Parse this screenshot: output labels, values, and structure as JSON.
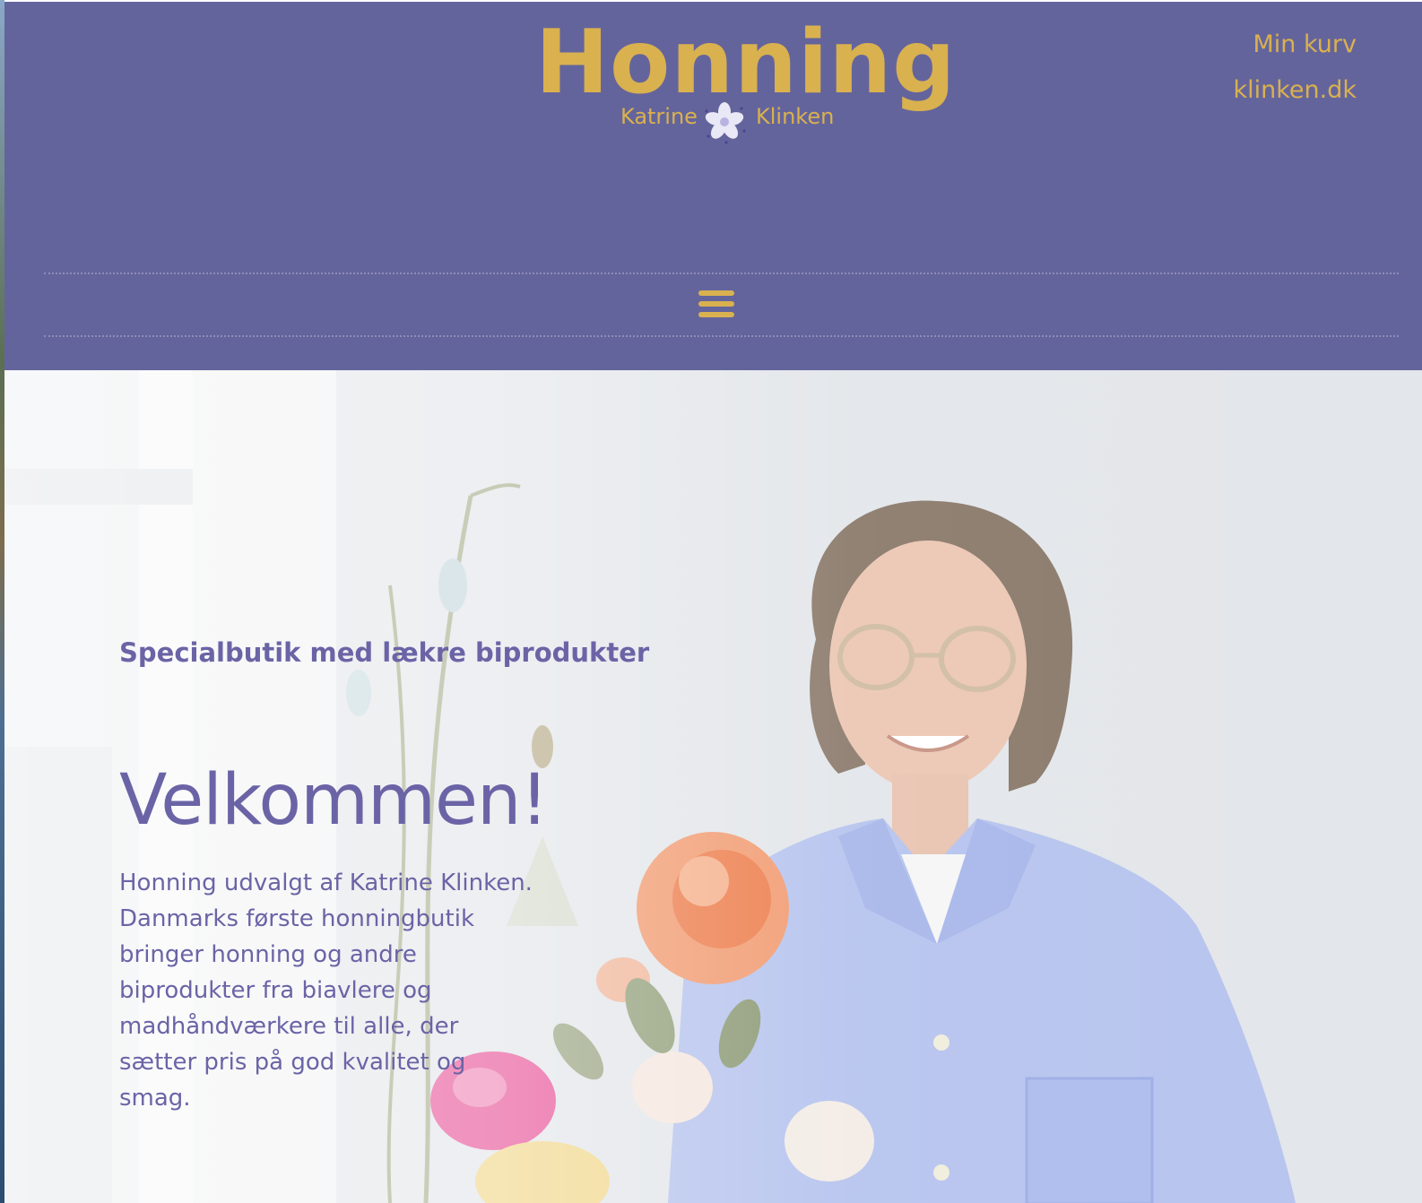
{
  "header": {
    "logo_word": "Honning",
    "logo_first_name": "Katrine",
    "logo_last_name": "Klinken",
    "links": {
      "cart": "Min kurv",
      "site": "klinken.dk"
    }
  },
  "nav": {
    "menu_icon": "hamburger-menu-icon"
  },
  "hero": {
    "subtitle": "Specialbutik med lækre biprodukter",
    "title": "Velkommen!",
    "body_line1": "Honning udvalgt af Katrine Klinken.",
    "body_line2": "Danmarks første honningbutik bringer honning og andre biprodukter fra biavlere og madhåndværkere til alle, der sætter pris på god kvalitet og smag."
  },
  "colors": {
    "header_bg": "#64649c",
    "gold": "#d9b14f",
    "text_purple": "#6a64a6"
  }
}
